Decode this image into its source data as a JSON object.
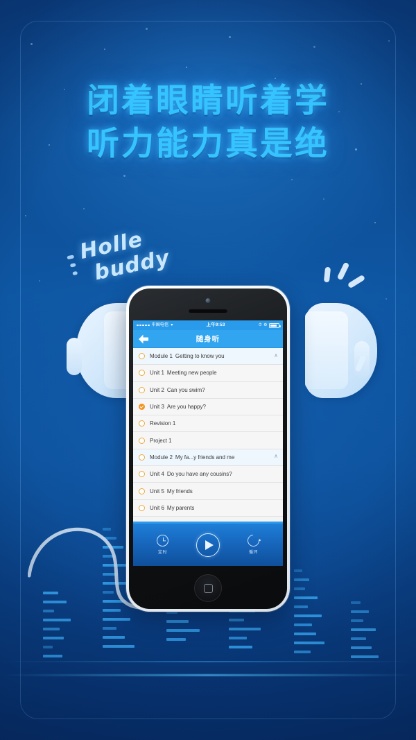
{
  "poster": {
    "headline_line1": "闭着眼睛听着学",
    "headline_line2": "听力能力真是绝",
    "script_line1": "Holle",
    "script_line2": "buddy",
    "accent_color": "#35c4ff",
    "background_color": "#0d4d95"
  },
  "phone": {
    "statusbar": {
      "carrier": "中国电信",
      "wifi_icon": "wifi-icon",
      "time": "上午9:53",
      "alarm_icon": "alarm-icon",
      "rotation_lock_icon": "rotation-lock-icon",
      "battery_icon": "battery-icon"
    },
    "navbar": {
      "back_icon": "back-arrow-icon",
      "title": "随身听"
    },
    "list": [
      {
        "type": "module",
        "lead": "Module 1",
        "title": "Getting to know you",
        "selected": false,
        "expanded": true,
        "chevron": "chevron-up-icon"
      },
      {
        "type": "unit",
        "lead": "Unit 1",
        "title": "Meeting new people",
        "selected": false
      },
      {
        "type": "unit",
        "lead": "Unit 2",
        "title": "Can you swim?",
        "selected": false
      },
      {
        "type": "unit",
        "lead": "Unit 3",
        "title": "Are you happy?",
        "selected": true
      },
      {
        "type": "unit",
        "lead": "Revision 1",
        "title": "",
        "selected": false
      },
      {
        "type": "unit",
        "lead": "Project 1",
        "title": "",
        "selected": false
      },
      {
        "type": "module",
        "lead": "Module 2",
        "title": "My fa...y friends and me",
        "selected": false,
        "expanded": true,
        "chevron": "chevron-up-icon"
      },
      {
        "type": "unit",
        "lead": "Unit 4",
        "title": "Do you have any cousins?",
        "selected": false
      },
      {
        "type": "unit",
        "lead": "Unit 5",
        "title": "My friends",
        "selected": false
      },
      {
        "type": "unit",
        "lead": "Unit 6",
        "title": "My parents",
        "selected": false
      }
    ],
    "player": {
      "timer_label": "定时",
      "timer_icon": "timer-icon",
      "play_icon": "play-icon",
      "loop_label": "循环",
      "loop_icon": "loop-icon"
    },
    "home_button_icon": "home-square-icon"
  },
  "decor": {
    "left_earcup": "headphone-earcup-left",
    "right_earcup": "headphone-earcup-right",
    "cable": "headphone-cable",
    "sound_sparks": "sound-spark-marks",
    "equalizer": "audio-equalizer-bars"
  }
}
